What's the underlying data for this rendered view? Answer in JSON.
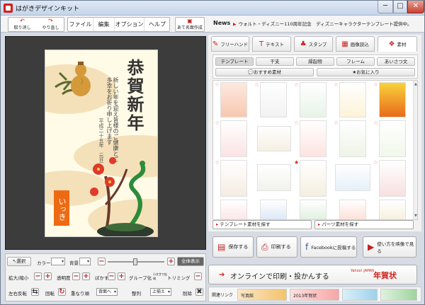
{
  "window": {
    "title": "はがきデザインキット",
    "min": "─",
    "max": "□",
    "close": "✕"
  },
  "toolbar": {
    "undo_label": "取り消し",
    "redo_label": "やり直し",
    "menus": [
      "ファイル",
      "編集",
      "オプション",
      "ヘルプ"
    ],
    "address_label": "あて名面作成",
    "news_label": "News",
    "news_text": "ウォルト・ディズニー110周年記念　ディズニーキャラクターテンプレート提供中。"
  },
  "card": {
    "greeting": "恭賀新年",
    "message": "新しい年を迎え皆様のご健康とご多幸をお祈り申し上げます",
    "date": "平成二十五年　元旦",
    "name": "いっき"
  },
  "bottom_tools": {
    "select_label": "選択",
    "color_label": "カラー",
    "bg_label": "背景",
    "fit_label": "全体表示",
    "zoom_label": "拡大/縮小",
    "opacity_label": "透明度",
    "blur_label": "ぼかす",
    "group_label": "グループ化",
    "group_sub": "小文字で拡縮",
    "trim_label": "トリミング",
    "flip_label": "左右反転",
    "rotate_label": "回転",
    "order_label": "重なり順",
    "back_option": "背面へ",
    "align_label": "整列",
    "up_option": "上揃え",
    "delete_label": "削除"
  },
  "right_panel": {
    "tabs": [
      "フリーハンド",
      "テキスト",
      "スタンプ",
      "画像読込",
      "素材"
    ],
    "subtabs": [
      "テンプレート",
      "干支",
      "縁起物",
      "フレーム",
      "あいさつ文"
    ],
    "recommended_label": "おすすめ素材",
    "favorites_label": "お気に入り",
    "find_template": "テンプレート素材を探す",
    "find_parts": "パーツ素材を探す"
  },
  "actions": {
    "save": "保存する",
    "print": "印刷する",
    "facebook": "Facebookに投稿する",
    "video": "使い方を映像で見る",
    "online": "オンラインで印刷・投かんする",
    "nenga_logo": "年賀状",
    "yahoo_text": "Yahoo! JAPAN",
    "related_links": "関連リンク",
    "banner1": "写真館",
    "banner2": "2013年賀状"
  },
  "colors": {
    "accent": "#d02018",
    "canvas_bg": "#3c3c3c",
    "card_bg": "#fffbe7",
    "name_box": "#ee6a12"
  },
  "icons": {
    "undo": "undo-icon",
    "redo": "redo-icon",
    "save": "save-icon",
    "print": "printer-icon",
    "facebook": "facebook-icon",
    "video": "play-icon"
  }
}
